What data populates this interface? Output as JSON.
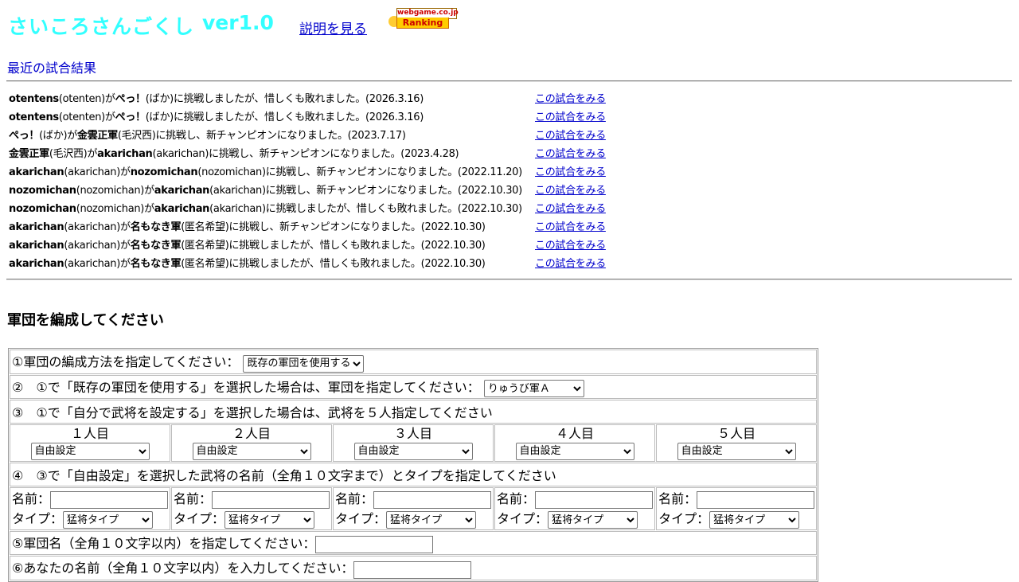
{
  "app": {
    "title": "さいころさんごくし",
    "version": "ver1.0"
  },
  "nav": {
    "help_link": "説明を見る"
  },
  "ranking_badge": {
    "top": "webgame.co.jp",
    "bottom": "Ranking"
  },
  "recent": {
    "heading": "最近の試合結果",
    "view_label": "この試合をみる",
    "rows": [
      {
        "a": "otentens",
        "a_id": "(otenten)が",
        "b": "ぺっ！",
        "b_id": "(ばか)に挑戦しましたが、惜しくも敗れました。(2026.3.16)"
      },
      {
        "a": "otentens",
        "a_id": "(otenten)が",
        "b": "ぺっ！",
        "b_id": "(ばか)に挑戦しましたが、惜しくも敗れました。(2026.3.16)"
      },
      {
        "a": "ぺっ！",
        "a_id": "(ばか)が",
        "b": "金雲正軍",
        "b_id": "(毛沢西)に挑戦し、新チャンピオンになりました。(2023.7.17)"
      },
      {
        "a": "金雲正軍",
        "a_id": "(毛沢西)が",
        "b": "akarichan",
        "b_id": "(akarichan)に挑戦し、新チャンピオンになりました。(2023.4.28)"
      },
      {
        "a": "akarichan",
        "a_id": "(akarichan)が",
        "b": "nozomichan",
        "b_id": "(nozomichan)に挑戦し、新チャンピオンになりました。(2022.11.20)"
      },
      {
        "a": "nozomichan",
        "a_id": "(nozomichan)が",
        "b": "akarichan",
        "b_id": "(akarichan)に挑戦し、新チャンピオンになりました。(2022.10.30)"
      },
      {
        "a": "nozomichan",
        "a_id": "(nozomichan)が",
        "b": "akarichan",
        "b_id": "(akarichan)に挑戦しましたが、惜しくも敗れました。(2022.10.30)"
      },
      {
        "a": "akarichan",
        "a_id": "(akarichan)が",
        "b": "名もなき軍",
        "b_id": "(匿名希望)に挑戦し、新チャンピオンになりました。(2022.10.30)"
      },
      {
        "a": "akarichan",
        "a_id": "(akarichan)が",
        "b": "名もなき軍",
        "b_id": "(匿名希望)に挑戦しましたが、惜しくも敗れました。(2022.10.30)"
      },
      {
        "a": "akarichan",
        "a_id": "(akarichan)が",
        "b": "名もなき軍",
        "b_id": "(匿名希望)に挑戦しましたが、惜しくも敗れました。(2022.10.30)"
      }
    ]
  },
  "form": {
    "heading": "軍団を編成してください",
    "step1": {
      "label": "①軍団の編成方法を指定してください：",
      "value": "既存の軍団を使用する"
    },
    "step2": {
      "label": "②　①で「既存の軍団を使用する」を選択した場合は、軍団を指定してください：",
      "value": "りゅうび軍Ａ"
    },
    "step3": {
      "label": "③　①で「自分で武将を設定する」を選択した場合は、武将を５人指定してください"
    },
    "slots": [
      {
        "label": "１人目",
        "value": "自由設定"
      },
      {
        "label": "２人目",
        "value": "自由設定"
      },
      {
        "label": "３人目",
        "value": "自由設定"
      },
      {
        "label": "４人目",
        "value": "自由設定"
      },
      {
        "label": "５人目",
        "value": "自由設定"
      }
    ],
    "step4": {
      "label": "④　③で「自由設定」を選択した武将の名前（全角１０文字まで）とタイプを指定してください"
    },
    "officer_name_label": "名前：",
    "officer_type_label": "タイプ：",
    "officers": [
      {
        "name": "",
        "type": "猛将タイプ"
      },
      {
        "name": "",
        "type": "猛将タイプ"
      },
      {
        "name": "",
        "type": "猛将タイプ"
      },
      {
        "name": "",
        "type": "猛将タイプ"
      },
      {
        "name": "",
        "type": "猛将タイプ"
      }
    ],
    "step5": {
      "label": "⑤軍団名（全角１０文字以内）を指定してください：",
      "value": ""
    },
    "step6": {
      "label": "⑥あなたの名前（全角１０文字以内）を入力してください：",
      "value": ""
    }
  }
}
